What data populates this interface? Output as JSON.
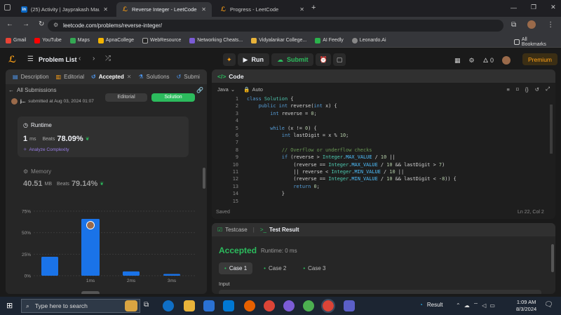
{
  "browser": {
    "tabs": [
      {
        "label": "(25) Activity | Jayprakash Maury…",
        "favicon": "in"
      },
      {
        "label": "Reverse Integer - LeetCode",
        "favicon": "lc"
      },
      {
        "label": "Progress - LeetCode",
        "favicon": "lc"
      }
    ],
    "url": "leetcode.com/problems/reverse-integer/",
    "bookmarks": [
      "Gmail",
      "YouTube",
      "Maps",
      "ApnaCollege",
      "WebResource",
      "Networking Cheats...",
      "Vidyalankar College...",
      "AI Feedly",
      "Leonardo.Ai"
    ],
    "all_bookmarks": "All Bookmarks"
  },
  "header": {
    "problem_list": "Problem List",
    "run": "Run",
    "submit": "Submit",
    "streak": "0",
    "premium": "Premium"
  },
  "left": {
    "tabs": [
      "Description",
      "Editorial",
      "Accepted",
      "Solutions",
      "Submi"
    ],
    "all_submissions": "All Submissions",
    "user": "j...",
    "submitted": "submitted at Aug 03, 2024 01:07",
    "editorial_btn": "Editorial",
    "solution_btn": "Solution",
    "runtime": {
      "label": "Runtime",
      "value": "1",
      "unit": "ms",
      "beats_label": "Beats",
      "beats": "78.09%",
      "analyze": "Analyze Complexity"
    },
    "memory": {
      "label": "Memory",
      "value": "40.51",
      "unit": "MB",
      "beats_label": "Beats",
      "beats": "79.14%"
    }
  },
  "chart_data": {
    "type": "bar",
    "categories": [
      "",
      "1ms",
      "2ms",
      "3ms"
    ],
    "values": [
      22,
      66,
      5,
      2
    ],
    "highlight_index": 1,
    "yticks": [
      "0%",
      "25%",
      "50%",
      "75%"
    ],
    "ylim": [
      0,
      75
    ],
    "xticks": [
      "1ms",
      "2ms",
      "3ms"
    ],
    "bar_color": "#1a73e8"
  },
  "code": {
    "title": "Code",
    "lang": "Java",
    "auto": "Auto",
    "lines": [
      {
        "n": "1",
        "t": "class Solution {"
      },
      {
        "n": "2",
        "t": "    public int reverse(int x) {"
      },
      {
        "n": "3",
        "t": "        int reverse = 0;"
      },
      {
        "n": "4",
        "t": ""
      },
      {
        "n": "5",
        "t": "        while (x != 0) {"
      },
      {
        "n": "6",
        "t": "            int lastDigit = x % 10;"
      },
      {
        "n": "7",
        "t": ""
      },
      {
        "n": "8",
        "t": "            // Overflow or underflow checks"
      },
      {
        "n": "9",
        "t": "            if (reverse > Integer.MAX_VALUE / 10 ||"
      },
      {
        "n": "10",
        "t": "                (reverse == Integer.MAX_VALUE / 10 && lastDigit > 7)"
      },
      {
        "n": "11",
        "t": "                || reverse < Integer.MIN_VALUE / 10 ||"
      },
      {
        "n": "12",
        "t": "                (reverse == Integer.MIN_VALUE / 10 && lastDigit < -8)) {"
      },
      {
        "n": "13",
        "t": "                return 0;"
      },
      {
        "n": "14",
        "t": "            }"
      },
      {
        "n": "15",
        "t": ""
      }
    ],
    "saved": "Saved",
    "cursor": "Ln 22, Col 2"
  },
  "result": {
    "testcase": "Testcase",
    "test_result": "Test Result",
    "status": "Accepted",
    "runtime": "Runtime: 0 ms",
    "cases": [
      "Case 1",
      "Case 2",
      "Case 3"
    ],
    "input_label": "Input"
  },
  "taskbar": {
    "search": "Type here to search",
    "weather": "Result",
    "time": "1:09 AM",
    "date": "8/3/2024"
  }
}
